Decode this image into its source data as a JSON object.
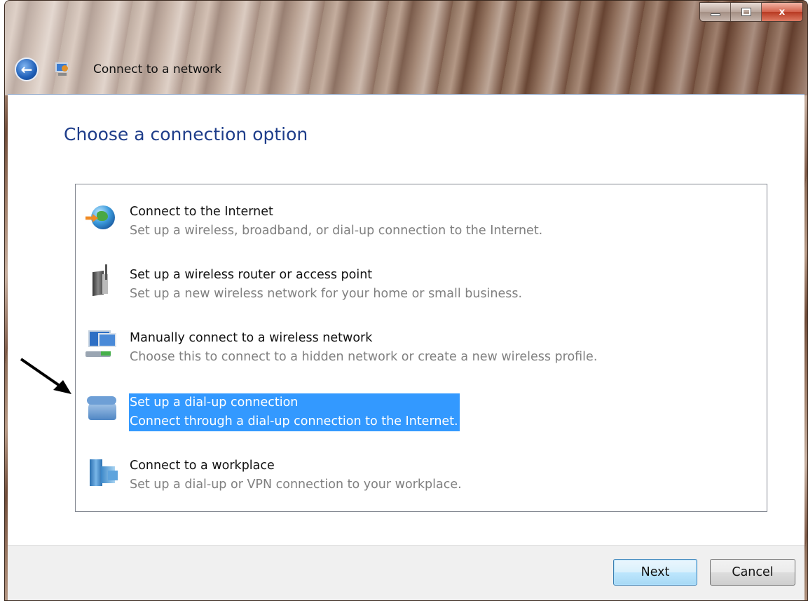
{
  "window": {
    "title": "Connect to a network",
    "caption": {
      "minimize": "minimize",
      "maximize": "maximize",
      "close": "x"
    }
  },
  "page": {
    "heading": "Choose a connection option"
  },
  "options": [
    {
      "title": "Connect to the Internet",
      "description": "Set up a wireless, broadband, or dial-up connection to the Internet.",
      "icon": "globe-icon",
      "selected": false
    },
    {
      "title": "Set up a wireless router or access point",
      "description": "Set up a new wireless network for your home or small business.",
      "icon": "router-icon",
      "selected": false
    },
    {
      "title": "Manually connect to a wireless network",
      "description": "Choose this to connect to a hidden network or create a new wireless profile.",
      "icon": "computer-network-icon",
      "selected": false
    },
    {
      "title": "Set up a dial-up connection",
      "description": "Connect through a dial-up connection to the Internet.",
      "icon": "telephone-icon",
      "selected": true
    },
    {
      "title": "Connect to a workplace",
      "description": "Set up a dial-up or VPN connection to your workplace.",
      "icon": "workplace-server-icon",
      "selected": false
    }
  ],
  "footer": {
    "next_label": "Next",
    "cancel_label": "Cancel"
  },
  "colors": {
    "heading": "#1e3d8a",
    "selection": "#3399ff",
    "description": "#808080"
  }
}
